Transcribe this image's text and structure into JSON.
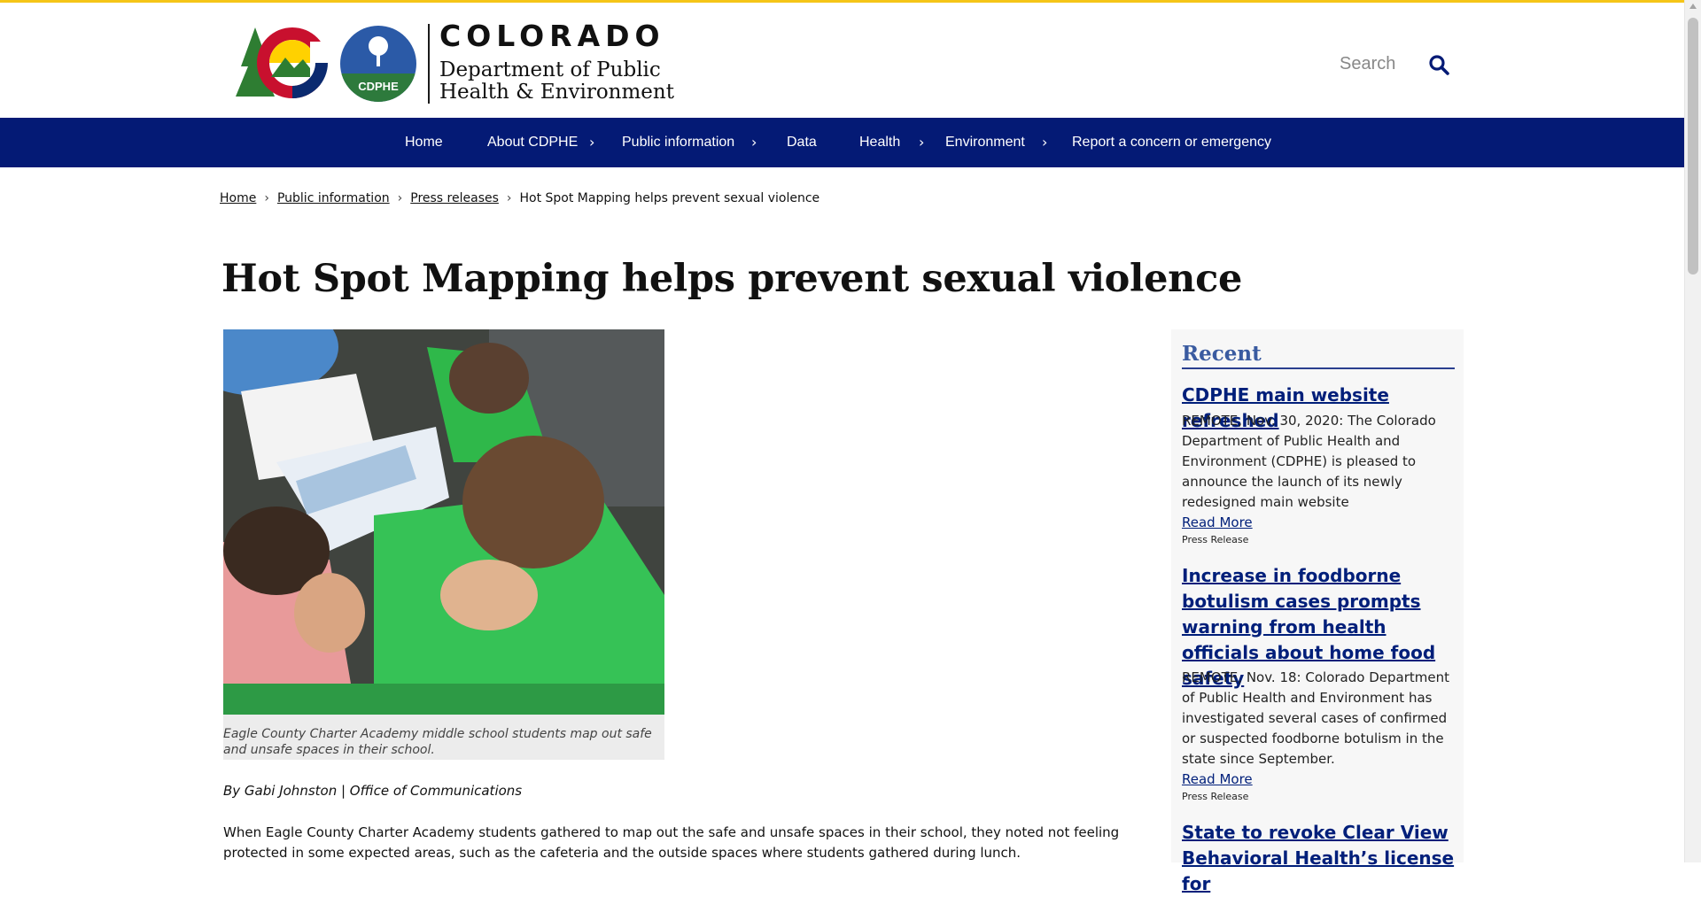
{
  "colors": {
    "nav_bg": "#041a75",
    "accent_top": "#f5c518",
    "link": "#001f7a",
    "sidebar_heading": "#3a5ba0"
  },
  "header": {
    "state_name": "COLORADO",
    "department_line1": "Department of Public",
    "department_line2": "Health & Environment",
    "cdphe_badge": "CDPHE",
    "search_label": "Search",
    "search_icon": "search-icon"
  },
  "nav": {
    "items": [
      {
        "label": "Home",
        "has_submenu": false
      },
      {
        "label": "About CDPHE",
        "has_submenu": true
      },
      {
        "label": "Public information",
        "has_submenu": true
      },
      {
        "label": "Data",
        "has_submenu": false
      },
      {
        "label": "Health",
        "has_submenu": true
      },
      {
        "label": "Environment",
        "has_submenu": true
      },
      {
        "label": "Report a concern or emergency",
        "has_submenu": false
      }
    ]
  },
  "breadcrumb": {
    "items": [
      "Home",
      "Public information",
      "Press releases"
    ],
    "current": "Hot Spot Mapping helps prevent sexual violence",
    "separator": "›"
  },
  "article": {
    "title": "Hot Spot Mapping helps prevent sexual violence",
    "image_caption": "Eagle County Charter Academy middle school students map out safe and unsafe spaces in their school.",
    "byline": "By Gabi Johnston | Office of Communications",
    "paragraph": "When Eagle County Charter Academy students gathered to map out the safe and unsafe spaces in their school, they noted not feeling protected in some expected areas, such as the cafeteria and the outside spaces where students gathered during lunch."
  },
  "sidebar": {
    "heading": "Recent",
    "items": [
      {
        "title": "CDPHE main website refreshed",
        "description": "REMOTE, Nov. 30, 2020: The Colorado Department of Public Health and Environment (CDPHE) is pleased to announce the launch of its newly redesigned main website",
        "read_more": "Read More",
        "type": "Press Release"
      },
      {
        "title": "Increase in foodborne botulism cases prompts warning from health officials about home food safety",
        "description": "REMOTE, Nov. 18: Colorado Department of Public Health and Environment has investigated several cases of confirmed or suspected foodborne botulism in the state since September.",
        "read_more": "Read More",
        "type": "Press Release"
      },
      {
        "title": "State to revoke Clear View Behavioral Health’s license for"
      }
    ]
  }
}
